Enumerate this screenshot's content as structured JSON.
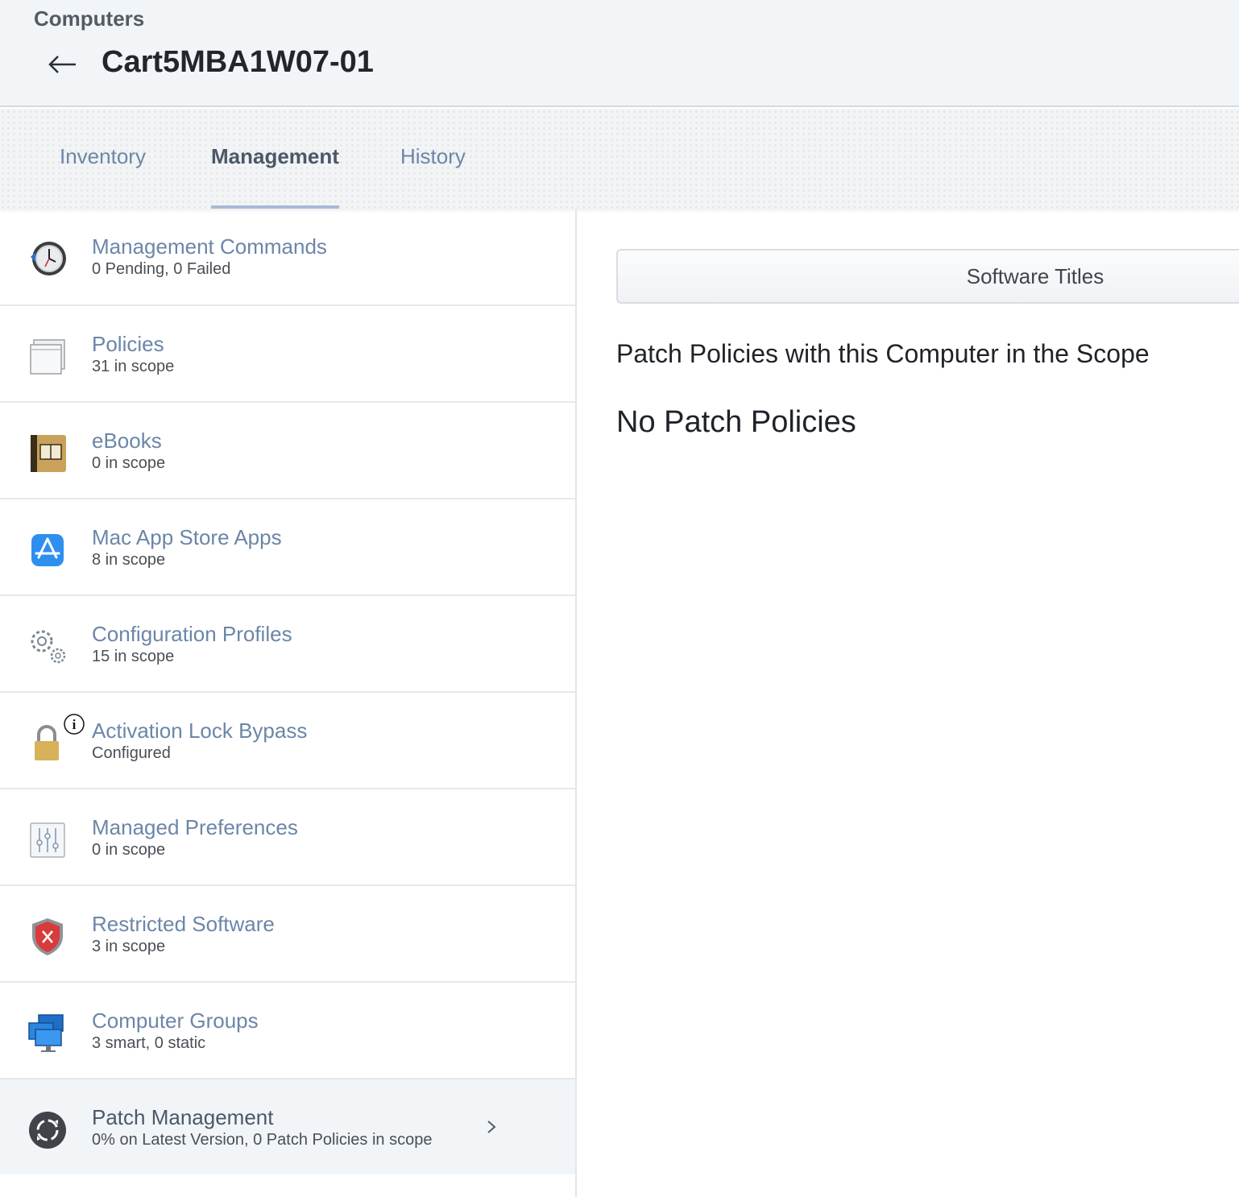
{
  "header": {
    "breadcrumb": "Computers",
    "title": "Cart5MBA1W07-01",
    "back_icon": "arrow-left-icon"
  },
  "tabs": [
    {
      "label": "Inventory",
      "active": false
    },
    {
      "label": "Management",
      "active": true
    },
    {
      "label": "History",
      "active": false
    }
  ],
  "sidebar": {
    "items": [
      {
        "title": "Management Commands",
        "sub": "0 Pending, 0 Failed",
        "icon": "clock-icon"
      },
      {
        "title": "Policies",
        "sub": "31 in scope",
        "icon": "window-stack-icon"
      },
      {
        "title": "eBooks",
        "sub": "0 in scope",
        "icon": "book-icon"
      },
      {
        "title": "Mac App Store Apps",
        "sub": "8 in scope",
        "icon": "app-store-icon"
      },
      {
        "title": "Configuration Profiles",
        "sub": "15 in scope",
        "icon": "gears-icon"
      },
      {
        "title": "Activation Lock Bypass",
        "sub": "Configured",
        "icon": "padlock-icon"
      },
      {
        "title": "Managed Preferences",
        "sub": "0 in scope",
        "icon": "sliders-icon"
      },
      {
        "title": "Restricted Software",
        "sub": "3 in scope",
        "icon": "shield-x-icon"
      },
      {
        "title": "Computer Groups",
        "sub": "3 smart, 0 static",
        "icon": "computers-icon"
      },
      {
        "title": "Patch Management",
        "sub": "0% on Latest Version, 0 Patch Policies in scope",
        "icon": "patch-icon",
        "selected": true
      }
    ]
  },
  "main": {
    "button_label": "Software Titles",
    "heading": "Patch Policies with this Computer in the Scope",
    "empty_message": "No Patch Policies"
  },
  "colors": {
    "link": "#6b86a8",
    "header_bg": "#f2f5f8",
    "tab_indicator": "#a7bbd4"
  }
}
